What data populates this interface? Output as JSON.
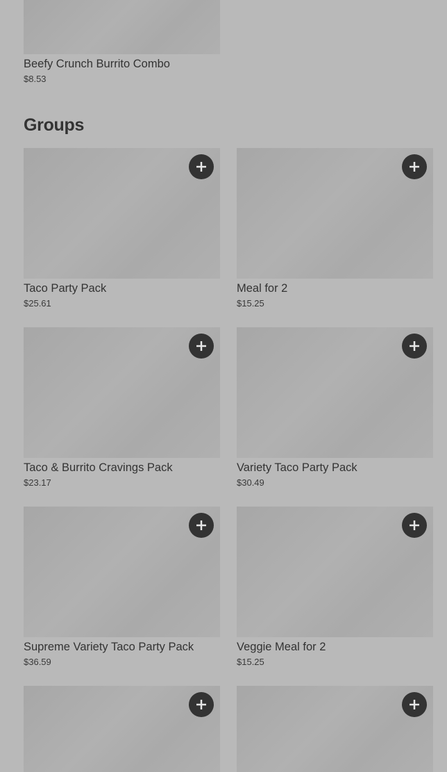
{
  "top_item": {
    "name": "Beefy Crunch Burrito Combo",
    "price": "$8.53"
  },
  "groups": {
    "title": "Groups",
    "items": [
      {
        "name": "Taco Party Pack",
        "price": "$25.61"
      },
      {
        "name": "Meal for 2",
        "price": "$15.25"
      },
      {
        "name": "Taco & Burrito Cravings Pack",
        "price": "$23.17"
      },
      {
        "name": "Variety Taco Party Pack",
        "price": "$30.49"
      },
      {
        "name": "Supreme Variety Taco Party Pack",
        "price": "$36.59"
      },
      {
        "name": "Veggie Meal for 2",
        "price": "$15.25"
      },
      {
        "name": "",
        "price": ""
      },
      {
        "name": "",
        "price": ""
      }
    ]
  },
  "icons": {
    "add": "plus-icon"
  },
  "colors": {
    "background": "#b9b9b9",
    "add_button": "#333333",
    "text": "#333333"
  }
}
